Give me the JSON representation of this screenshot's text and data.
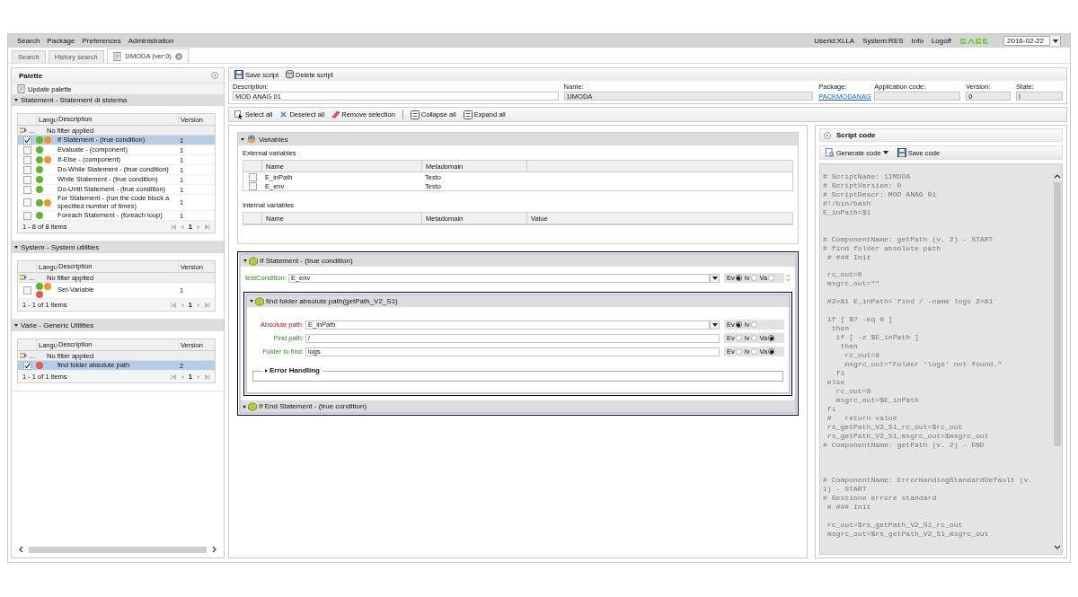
{
  "menu": [
    {
      "label": "Search"
    },
    {
      "label": "Package"
    },
    {
      "label": "Preferences"
    },
    {
      "label": "Administration"
    }
  ],
  "user_bar": {
    "userid": "Userid:XLLA",
    "system": "System:RES",
    "links": [
      {
        "label": "Info"
      },
      {
        "label": "Logoff"
      }
    ],
    "date": "2016-02-22"
  },
  "tabs": [
    {
      "label": "Search",
      "selected": false,
      "closable": false
    },
    {
      "label": "History search",
      "selected": false,
      "closable": false
    },
    {
      "label": "1IMODA (ver:0)",
      "selected": true,
      "closable": true
    }
  ],
  "palette": {
    "title": "Palette",
    "update": "Update palette",
    "sections": [
      {
        "title": "Statement - Statement di sistema",
        "expanded": true,
        "columns": [
          "Langu",
          "Description",
          "Version"
        ],
        "filter_button": "...",
        "filter": "No filter applied",
        "pager": {
          "summary": "1 - 8 of 8 items",
          "page": "1"
        },
        "rows": [
          {
            "checked": true,
            "selected": true,
            "badges": [
              {
                "color": "#5cb82e"
              },
              {
                "color": "#f0952a"
              }
            ],
            "description": "If Statement - (true condition)",
            "version": "1"
          },
          {
            "checked": false,
            "selected": false,
            "badges": [
              {
                "color": "#5cb82e"
              }
            ],
            "description": "Evaluate - (component)",
            "version": "1"
          },
          {
            "checked": false,
            "selected": false,
            "badges": [
              {
                "color": "#5cb82e"
              },
              {
                "color": "#f0952a"
              }
            ],
            "description": "If-Else - (component)",
            "version": "1"
          },
          {
            "checked": false,
            "selected": false,
            "badges": [
              {
                "color": "#5cb82e"
              }
            ],
            "description": "Do-While Statement - (true condition)",
            "version": "1"
          },
          {
            "checked": false,
            "selected": false,
            "badges": [
              {
                "color": "#5cb82e"
              }
            ],
            "description": "While Statement - (true condition)",
            "version": "1"
          },
          {
            "checked": false,
            "selected": false,
            "badges": [
              {
                "color": "#5cb82e"
              }
            ],
            "description": "Do-Until Statement - (true condition)",
            "version": "1"
          },
          {
            "checked": false,
            "selected": false,
            "badges": [
              {
                "color": "#5cb82e"
              },
              {
                "color": "#f0952a"
              }
            ],
            "description": "For Statement - (run the code block a specified number of times)",
            "version": "1"
          },
          {
            "checked": false,
            "selected": false,
            "badges": [
              {
                "color": "#5cb82e"
              }
            ],
            "description": "Foreach Statement - (foreach loop)",
            "version": "1"
          }
        ]
      },
      {
        "title": "System - System utilities",
        "expanded": true,
        "columns": [
          "Langu",
          "Description",
          "Version"
        ],
        "filter_button": "...",
        "filter": "No filter applied",
        "pager": {
          "summary": "1 - 1 of 1 items",
          "page": "1"
        },
        "rows": [
          {
            "checked": false,
            "selected": false,
            "badges": [
              {
                "color": "#5cb82e"
              },
              {
                "color": "#f0952a"
              },
              {
                "color": "#e05a4f"
              }
            ],
            "description": "Set-Variable",
            "version": "1"
          }
        ]
      },
      {
        "title": "Varie - Generic Utilities",
        "expanded": true,
        "columns": [
          "Langu",
          "Description",
          "Version"
        ],
        "filter_button": "...",
        "filter": "No filter applied",
        "pager": {
          "summary": "1 - 1 of 1 items",
          "page": "1"
        },
        "rows": [
          {
            "checked": true,
            "selected": true,
            "badges": [
              {
                "color": "#e05a4f"
              }
            ],
            "description": "find folder absolute path",
            "version": "2"
          }
        ]
      }
    ]
  },
  "script_toolbar": [
    {
      "label": "Save script",
      "kind": "save"
    },
    {
      "label": "Delete script",
      "kind": "delete"
    }
  ],
  "fields": [
    {
      "label": "Description:",
      "kind": "input",
      "value": "MOD ANAG 01",
      "readonly": false
    },
    {
      "label": "Name:",
      "kind": "input",
      "value": "1IMODA",
      "readonly": true
    },
    {
      "label": "Package:",
      "kind": "link",
      "value": "PACKMODANAG"
    },
    {
      "label": "Application code:",
      "kind": "input",
      "readonly": true
    },
    {
      "label": "Version:",
      "kind": "input",
      "value": "0",
      "readonly": true
    },
    {
      "label": "State:",
      "kind": "input",
      "value": "I",
      "readonly": true
    }
  ],
  "edit_toolbar": [
    {
      "label": "Select all",
      "kind": "select"
    },
    {
      "label": "Deselect all",
      "kind": "deselect"
    },
    {
      "label": "Remove selection",
      "kind": "remove"
    },
    {
      "label": "Collapse all",
      "kind": "collapse"
    },
    {
      "label": "Expand all",
      "kind": "expand"
    }
  ],
  "variables": {
    "title": "Variables",
    "expanded": true,
    "external": {
      "title": "External variables",
      "columns": [
        "Name",
        "Metadomain"
      ],
      "rows": [
        {
          "checked": false,
          "name": "E_inPath",
          "metadomain": "Testo"
        },
        {
          "checked": false,
          "name": "E_env",
          "metadomain": "Testo"
        }
      ]
    },
    "internal": {
      "title": "Internal variables",
      "columns": [
        "Name",
        "Metadomain",
        "Value"
      ]
    }
  },
  "statements": [
    {
      "title": "If Statement - (true condition)",
      "expanded": true,
      "selected": true,
      "params": [
        {
          "label": "testCondition:",
          "required": false,
          "value": "E_env",
          "dropdown": true,
          "reorder": true,
          "options": [
            {
              "label": "Ev",
              "selected": true
            },
            {
              "label": "Iv",
              "selected": false
            },
            {
              "label": "Va",
              "selected": false
            }
          ]
        }
      ],
      "children": [
        {
          "title": "find folder absolute path(getPath_V2_S1)",
          "expanded": true,
          "selected": true,
          "params": [
            {
              "label": "Absolute path:",
              "required": true,
              "value": "E_inPath",
              "dropdown": true,
              "reorder": false,
              "options": [
                {
                  "label": "Ev",
                  "selected": true
                },
                {
                  "label": "Iv",
                  "selected": false
                }
              ]
            },
            {
              "label": "Find path:",
              "required": false,
              "value": "/",
              "dropdown": false,
              "reorder": false,
              "options": [
                {
                  "label": "Ev",
                  "selected": false
                },
                {
                  "label": "Iv",
                  "selected": false
                },
                {
                  "label": "Va",
                  "selected": true
                }
              ]
            },
            {
              "label": "Folder to find:",
              "required": false,
              "value": "logs",
              "dropdown": false,
              "reorder": false,
              "options": [
                {
                  "label": "Ev",
                  "selected": false
                },
                {
                  "label": "Iv",
                  "selected": false
                },
                {
                  "label": "Va",
                  "selected": true
                }
              ]
            }
          ],
          "error_handling": {
            "title": "Error Handling",
            "expanded": false
          }
        }
      ],
      "end": {
        "title": "If End Statement - (true condition)",
        "expanded": false
      }
    }
  ],
  "script": {
    "title": "Script code",
    "toolbar": [
      {
        "label": "Generate code",
        "kind": "generate",
        "dropdown": true
      },
      {
        "label": "Save code",
        "kind": "save",
        "dropdown": false
      }
    ],
    "code": "# ScriptName: 1IMODA\n# ScriptVersion: 0\n# ScriptDescr: MOD ANAG 01\n#!/bin/bash\nE_inPath=$1\n\n\n# ComponentName: getPath (v. 2) - START\n# find folder absolute path\n # ### Init\n\n rc_out=0\n msgrc_out=\"\"\n\n #2>&1 E_inPath=`find / -name logs 2>&1`\n\n if [ $? -eq 0 ]\n  then\n   if [ -z $E_inPath ]\n    then\n     rc_out=8\n     msgrc_out=\"Folder 'logs' not found.\"\n   fi\n else\n   rc_out=8\n   msgrc_out=$E_inPath\n fi\n #   return value\n rs_getPath_V2_S1_rc_out=$rc_out\n rs_getPath_V2_S1_msgrc_out=$msgrc_out\n# ComponentName: getPath (v. 2) - END\n\n\n\n# ComponentName: ErrorHandingStandardDefault (v.\n1) - START\n# Gestione errore standard\n # ### Init\n\n rc_out=$rs_getPath_V2_S1_rc_out\n msgrc_out=$rs_getPath_V2_S1_msgrc_out"
  }
}
